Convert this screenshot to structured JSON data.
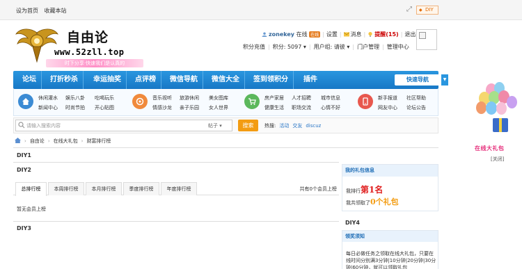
{
  "topbar": {
    "set_home": "设为首页",
    "bookmark": "收藏本站",
    "diy": "DIY"
  },
  "logo": {
    "title": "自由论",
    "url": "www.52zll.top",
    "slogan": "时下分享·快速我们是认真的"
  },
  "user": {
    "name": "zonekey",
    "status": "在线",
    "status_badge": "在线",
    "settings": "设置",
    "messages": "消息",
    "reminders": "提醒(15)",
    "logout": "退出",
    "credits_label": "积分充值",
    "points": "积分: 5097",
    "usergroup": "用户组: 请彼",
    "portal": "门户管理",
    "admin": "管理中心"
  },
  "nav": {
    "items": [
      "论坛",
      "打折秒杀",
      "幸运抽奖",
      "点评榜",
      "微信导航",
      "微信大全",
      "签到领积分",
      "插件"
    ],
    "quick": "快速导航"
  },
  "subnav": {
    "groups": [
      {
        "links": [
          "休闲灌水",
          "娱乐八卦",
          "吃喝玩乐",
          "新闻中心",
          "时尚节拍",
          "开心贴图"
        ],
        "color": "#3b8bd4",
        "icon": "home-icon"
      },
      {
        "links": [
          "音乐视听",
          "旅游休闲",
          "美女图库",
          "情感沙龙",
          "亲子乐园",
          "女人世界"
        ],
        "color": "#f08a3c",
        "icon": "music-icon"
      },
      {
        "links": [
          "房产家居",
          "人才招聘",
          "城市信息",
          "健康生活",
          "职场交流",
          "心情不好"
        ],
        "color": "#5cb85c",
        "icon": "cart-icon"
      },
      {
        "links": [
          "新手报道",
          "社区帮助",
          "网友中心",
          "论坛公告"
        ],
        "color": "#e8584e",
        "icon": "phone-icon"
      }
    ]
  },
  "search": {
    "placeholder": "请输入搜索内容",
    "type": "帖子",
    "button": "搜索",
    "hot_label": "热搜:",
    "hot": [
      "活动",
      "交友",
      "discuz"
    ]
  },
  "breadcrumb": [
    "自由论",
    "在线大礼包",
    "财富排行榜"
  ],
  "diy": {
    "diy1": "DIY1",
    "diy2": "DIY2",
    "diy3": "DIY3",
    "diy4": "DIY4"
  },
  "tabs": {
    "items": [
      "总排行榜",
      "本周排行榜",
      "本月排行榜",
      "季度排行榜",
      "年度排行榜"
    ],
    "count": "共有0个会员上榜",
    "empty": "暂无会员上榜"
  },
  "gift_box": {
    "title": "我的礼包信息",
    "rank_prefix": "我排行",
    "rank": "第1名",
    "got_prefix": "我共领取了",
    "got": "0个礼包"
  },
  "notice": {
    "title": "领奖须知",
    "text": "每日必做任务之领取在线大礼包，只要在线时间分别满3分钟|10分钟|20分钟|30分钟|60分钟，就可以领取礼包"
  },
  "float": {
    "caption": "在线大礼包",
    "close": "[关闭]"
  }
}
